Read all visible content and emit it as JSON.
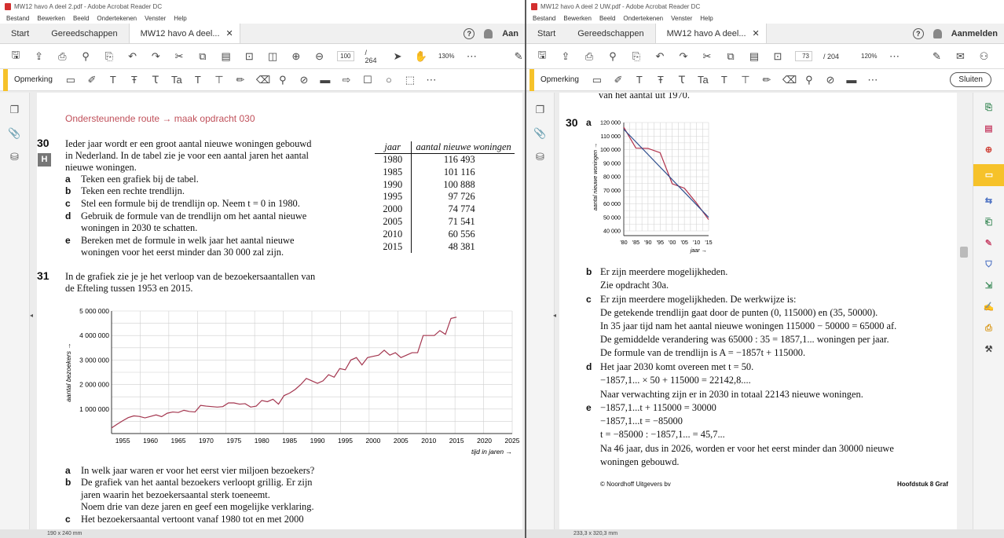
{
  "left": {
    "title": "MW12 havo A deel 2.pdf - Adobe Acrobat Reader DC",
    "menu": [
      "Bestand",
      "Bewerken",
      "Beeld",
      "Ondertekenen",
      "Venster",
      "Help"
    ],
    "tabs": [
      "Start",
      "Gereedschappen",
      "MW12 havo A deel..."
    ],
    "account": "Aan",
    "page_current": "100",
    "page_total": "/ 264",
    "zoom": "130%",
    "comment_label": "Opmerking",
    "status": "190 x 240 mm",
    "subtitle": "Ondersteunende route → maak opdracht 030",
    "q30": {
      "num": "30",
      "badge": "H",
      "intro": [
        "Ieder jaar wordt er een groot aantal nieuwe woningen gebouwd",
        "in Nederland. In de tabel zie je voor een aantal jaren het aantal",
        "nieuwe woningen."
      ],
      "items": [
        {
          "l": "a",
          "t": [
            "Teken een grafiek bij de tabel."
          ]
        },
        {
          "l": "b",
          "t": [
            "Teken een rechte trendlijn."
          ]
        },
        {
          "l": "c",
          "t": [
            "Stel een formule bij de trendlijn op. Neem t = 0 in 1980."
          ]
        },
        {
          "l": "d",
          "t": [
            "Gebruik de formule van de trendlijn om het aantal nieuwe",
            "woningen in 2030 te schatten."
          ]
        },
        {
          "l": "e",
          "t": [
            "Bereken met de formule in welk jaar het aantal nieuwe",
            "woningen voor het eerst minder dan 30 000 zal zijn."
          ]
        }
      ],
      "table": {
        "h1": "jaar",
        "h2": "aantal nieuwe woningen",
        "rows": [
          [
            "1980",
            "116 493"
          ],
          [
            "1985",
            "101 116"
          ],
          [
            "1990",
            "100 888"
          ],
          [
            "1995",
            "97 726"
          ],
          [
            "2000",
            "74 774"
          ],
          [
            "2005",
            "71 541"
          ],
          [
            "2010",
            "60 556"
          ],
          [
            "2015",
            "48 381"
          ]
        ]
      }
    },
    "q31": {
      "num": "31",
      "intro": [
        "In de grafiek zie je je het verloop van de bezoekersaantallen van",
        "de Efteling tussen 1953 en 2015."
      ],
      "items": [
        {
          "l": "a",
          "t": [
            "In welk jaar waren er voor het eerst vier miljoen bezoekers?"
          ]
        },
        {
          "l": "b",
          "t": [
            "De grafiek van het aantal bezoekers verloopt grillig. Er zijn",
            "jaren waarin het bezoekersaantal sterk toeneemt.",
            "Noem drie van deze jaren en geef een mogelijke verklaring."
          ]
        },
        {
          "l": "c",
          "t": [
            "Het bezoekersaantal vertoont vanaf 1980 tot en met 2000"
          ]
        }
      ]
    }
  },
  "right": {
    "title": "MW12 havo A deel 2 UW.pdf - Adobe Acrobat Reader DC",
    "menu": [
      "Bestand",
      "Bewerken",
      "Beeld",
      "Ondertekenen",
      "Venster",
      "Help"
    ],
    "tabs": [
      "Start",
      "Gereedschappen",
      "MW12 havo A deel..."
    ],
    "account": "Aanmelden",
    "page_current": "73",
    "page_total": "/ 204",
    "zoom": "120%",
    "comment_label": "Opmerking",
    "close_label": "Sluiten",
    "status": "233,3 x 320,3 mm",
    "top_text": "van het aantal uit 1970.",
    "ans_num": "30",
    "ans_a": "a",
    "answers": [
      {
        "l": "b",
        "t": [
          "Er zijn meerdere mogelijkheden.",
          "Zie opdracht 30a."
        ]
      },
      {
        "l": "c",
        "t": [
          "Er zijn meerdere mogelijkheden. De werkwijze is:",
          "De getekende trendlijn gaat door de punten (0, 115000) en (35, 50000).",
          "In 35 jaar tijd nam het aantal nieuwe woningen 115000 − 50000 = 65000 af.",
          "De gemiddelde verandering was 65000 : 35 = 1857,1... woningen per jaar.",
          "De formule van de trendlijn is A = −1857t + 115000."
        ]
      },
      {
        "l": "d",
        "t": [
          "Het jaar 2030 komt overeen met t = 50.",
          "−1857,1... × 50 + 115000 = 22142,8....",
          "Naar verwachting zijn er in 2030 in totaal 22143 nieuwe woningen."
        ]
      },
      {
        "l": "e",
        "t": [
          "−1857,1...t + 115000 = 30000",
          "−1857,1...t = −85000",
          "t = −85000 : −1857,1... = 45,7...",
          "Na 46 jaar, dus in 2026, worden er voor het eerst minder dan 30000 nieuwe",
          "woningen gebouwd."
        ]
      }
    ],
    "footer_left": "© Noordhoff Uitgevers bv",
    "footer_right": "Hoofdstuk 8 Graf"
  },
  "chart_data": [
    {
      "type": "line",
      "title": "",
      "xlabel": "tijd in jaren →",
      "ylabel": "aantal bezoekers →",
      "xlim": [
        1953,
        2025
      ],
      "ylim": [
        0,
        5000000
      ],
      "xticks": [
        "1955",
        "1960",
        "1965",
        "1970",
        "1975",
        "1980",
        "1985",
        "1990",
        "1995",
        "2000",
        "2005",
        "2010",
        "2015",
        "2020",
        "2025"
      ],
      "yticks": [
        "1 000 000",
        "2 000 000",
        "3 000 000",
        "4 000 000",
        "5 000 000"
      ],
      "color": "#a3354e",
      "x": [
        1953,
        1954,
        1955,
        1956,
        1957,
        1958,
        1959,
        1960,
        1961,
        1962,
        1963,
        1964,
        1965,
        1966,
        1967,
        1968,
        1969,
        1970,
        1971,
        1972,
        1973,
        1974,
        1975,
        1976,
        1977,
        1978,
        1979,
        1980,
        1981,
        1982,
        1983,
        1984,
        1985,
        1986,
        1987,
        1988,
        1989,
        1990,
        1991,
        1992,
        1993,
        1994,
        1995,
        1996,
        1997,
        1998,
        1999,
        2000,
        2001,
        2002,
        2003,
        2004,
        2005,
        2006,
        2007,
        2008,
        2009,
        2010,
        2011,
        2012,
        2013,
        2014,
        2015
      ],
      "y": [
        230000,
        380000,
        520000,
        650000,
        720000,
        700000,
        640000,
        700000,
        760000,
        690000,
        830000,
        880000,
        860000,
        950000,
        900000,
        880000,
        1150000,
        1120000,
        1100000,
        1080000,
        1100000,
        1250000,
        1250000,
        1200000,
        1220000,
        1080000,
        1120000,
        1350000,
        1300000,
        1400000,
        1200000,
        1550000,
        1650000,
        1800000,
        2000000,
        2250000,
        2150000,
        2050000,
        2150000,
        2400000,
        2300000,
        2650000,
        2600000,
        3000000,
        3100000,
        2800000,
        3100000,
        3150000,
        3200000,
        3400000,
        3200000,
        3300000,
        3100000,
        3200000,
        3300000,
        3300000,
        4000000,
        4000000,
        4000000,
        4200000,
        4050000,
        4700000,
        4750000
      ]
    },
    {
      "type": "line",
      "title": "",
      "xlabel": "jaar →",
      "ylabel": "aantal nieuwe woningen →",
      "xlim": [
        1980,
        2015
      ],
      "ylim": [
        40000,
        120000
      ],
      "xticks": [
        "'80",
        "'85",
        "'90",
        "'95",
        "'00",
        "'05",
        "'10",
        "'15"
      ],
      "yticks": [
        "40 000",
        "50 000",
        "60 000",
        "70 000",
        "80 000",
        "90 000",
        "100 000",
        "110 000",
        "120 000"
      ],
      "series": [
        {
          "color": "#b0304a",
          "x": [
            1980,
            1985,
            1990,
            1995,
            2000,
            2005,
            2010,
            2015
          ],
          "y": [
            116493,
            101116,
            100888,
            97726,
            74774,
            71541,
            60556,
            48381
          ]
        },
        {
          "color": "#2b4c8c",
          "x": [
            1980,
            2015
          ],
          "y": [
            115000,
            50000
          ]
        }
      ]
    }
  ]
}
